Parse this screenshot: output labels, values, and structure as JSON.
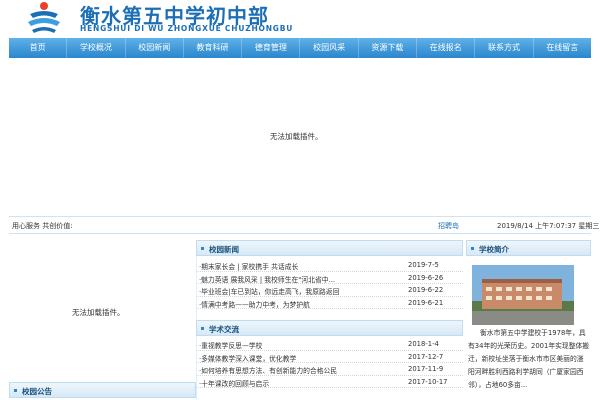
{
  "header": {
    "title": "衡水第五中学初中部",
    "subtitle": "HENGSHUI  DI WU ZHONGXUE CHUZHONGBU"
  },
  "nav": {
    "items": [
      "首页",
      "学校概况",
      "校园新闻",
      "教育科研",
      "德育管理",
      "校园风采",
      "资源下载",
      "在线报名",
      "联系方式",
      "在线留言"
    ]
  },
  "plugin_message": "无法加载插件。",
  "info_bar": {
    "motto": "用心服务 共创价值:",
    "recruit": "招聘岛",
    "datetime": "2019/8/14 上午7:07:37 星期三"
  },
  "school_news": {
    "title": "校园新闻",
    "items": [
      {
        "title": "·期末家长会 | 家校携手 共话成长",
        "date": "2019-7-5"
      },
      {
        "title": "·魅力英语 展我风采 | 我校师生在\"河北省中...",
        "date": "2019-6-26"
      },
      {
        "title": "·毕业班会|车已到站，你远走高飞，我原路返回",
        "date": "2019-6-22"
      },
      {
        "title": "·情满中考路——助力中考，为梦护航",
        "date": "2019-6-21"
      }
    ]
  },
  "academic": {
    "title": "学术交流",
    "items": [
      {
        "title": "·重视教学反思—学校",
        "date": "2018-1-4"
      },
      {
        "title": "·多媒体教学深入课堂，优化教学",
        "date": "2017-12-7"
      },
      {
        "title": "·如何培养有思想方法、有创新能力的合格公民",
        "date": "2017-11-9"
      },
      {
        "title": "·十年课改的回顾与启示",
        "date": "2017-10-17"
      }
    ]
  },
  "profile": {
    "title": "学校简介",
    "text": "衡水市第五中学建校于1978年，具有34年的光荣历史。2001年实现整体搬迁，新校址坐落于衡水市市区美丽的滏阳河畔胜利西路利学胡同（广厦家园西邻），占地60多亩..."
  },
  "notice": {
    "title": "校园公告"
  },
  "colors": {
    "brand": "#1c6fb6",
    "nav_top": "#5fb1e8",
    "nav_bottom": "#2a86cd"
  }
}
